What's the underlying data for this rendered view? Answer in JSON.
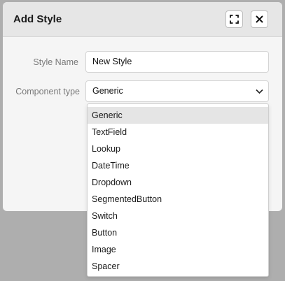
{
  "dialog": {
    "title": "Add Style",
    "expand_icon": "expand-icon",
    "close_icon": "close-icon"
  },
  "form": {
    "style_name_label": "Style Name",
    "style_name_value": "New Style",
    "component_type_label": "Component type",
    "component_type_value": "Generic",
    "chevron_icon": "chevron-down-icon"
  },
  "dropdown": {
    "options": [
      "Generic",
      "TextField",
      "Lookup",
      "DateTime",
      "Dropdown",
      "SegmentedButton",
      "Switch",
      "Button",
      "Image",
      "Spacer"
    ],
    "selected": "Generic"
  }
}
